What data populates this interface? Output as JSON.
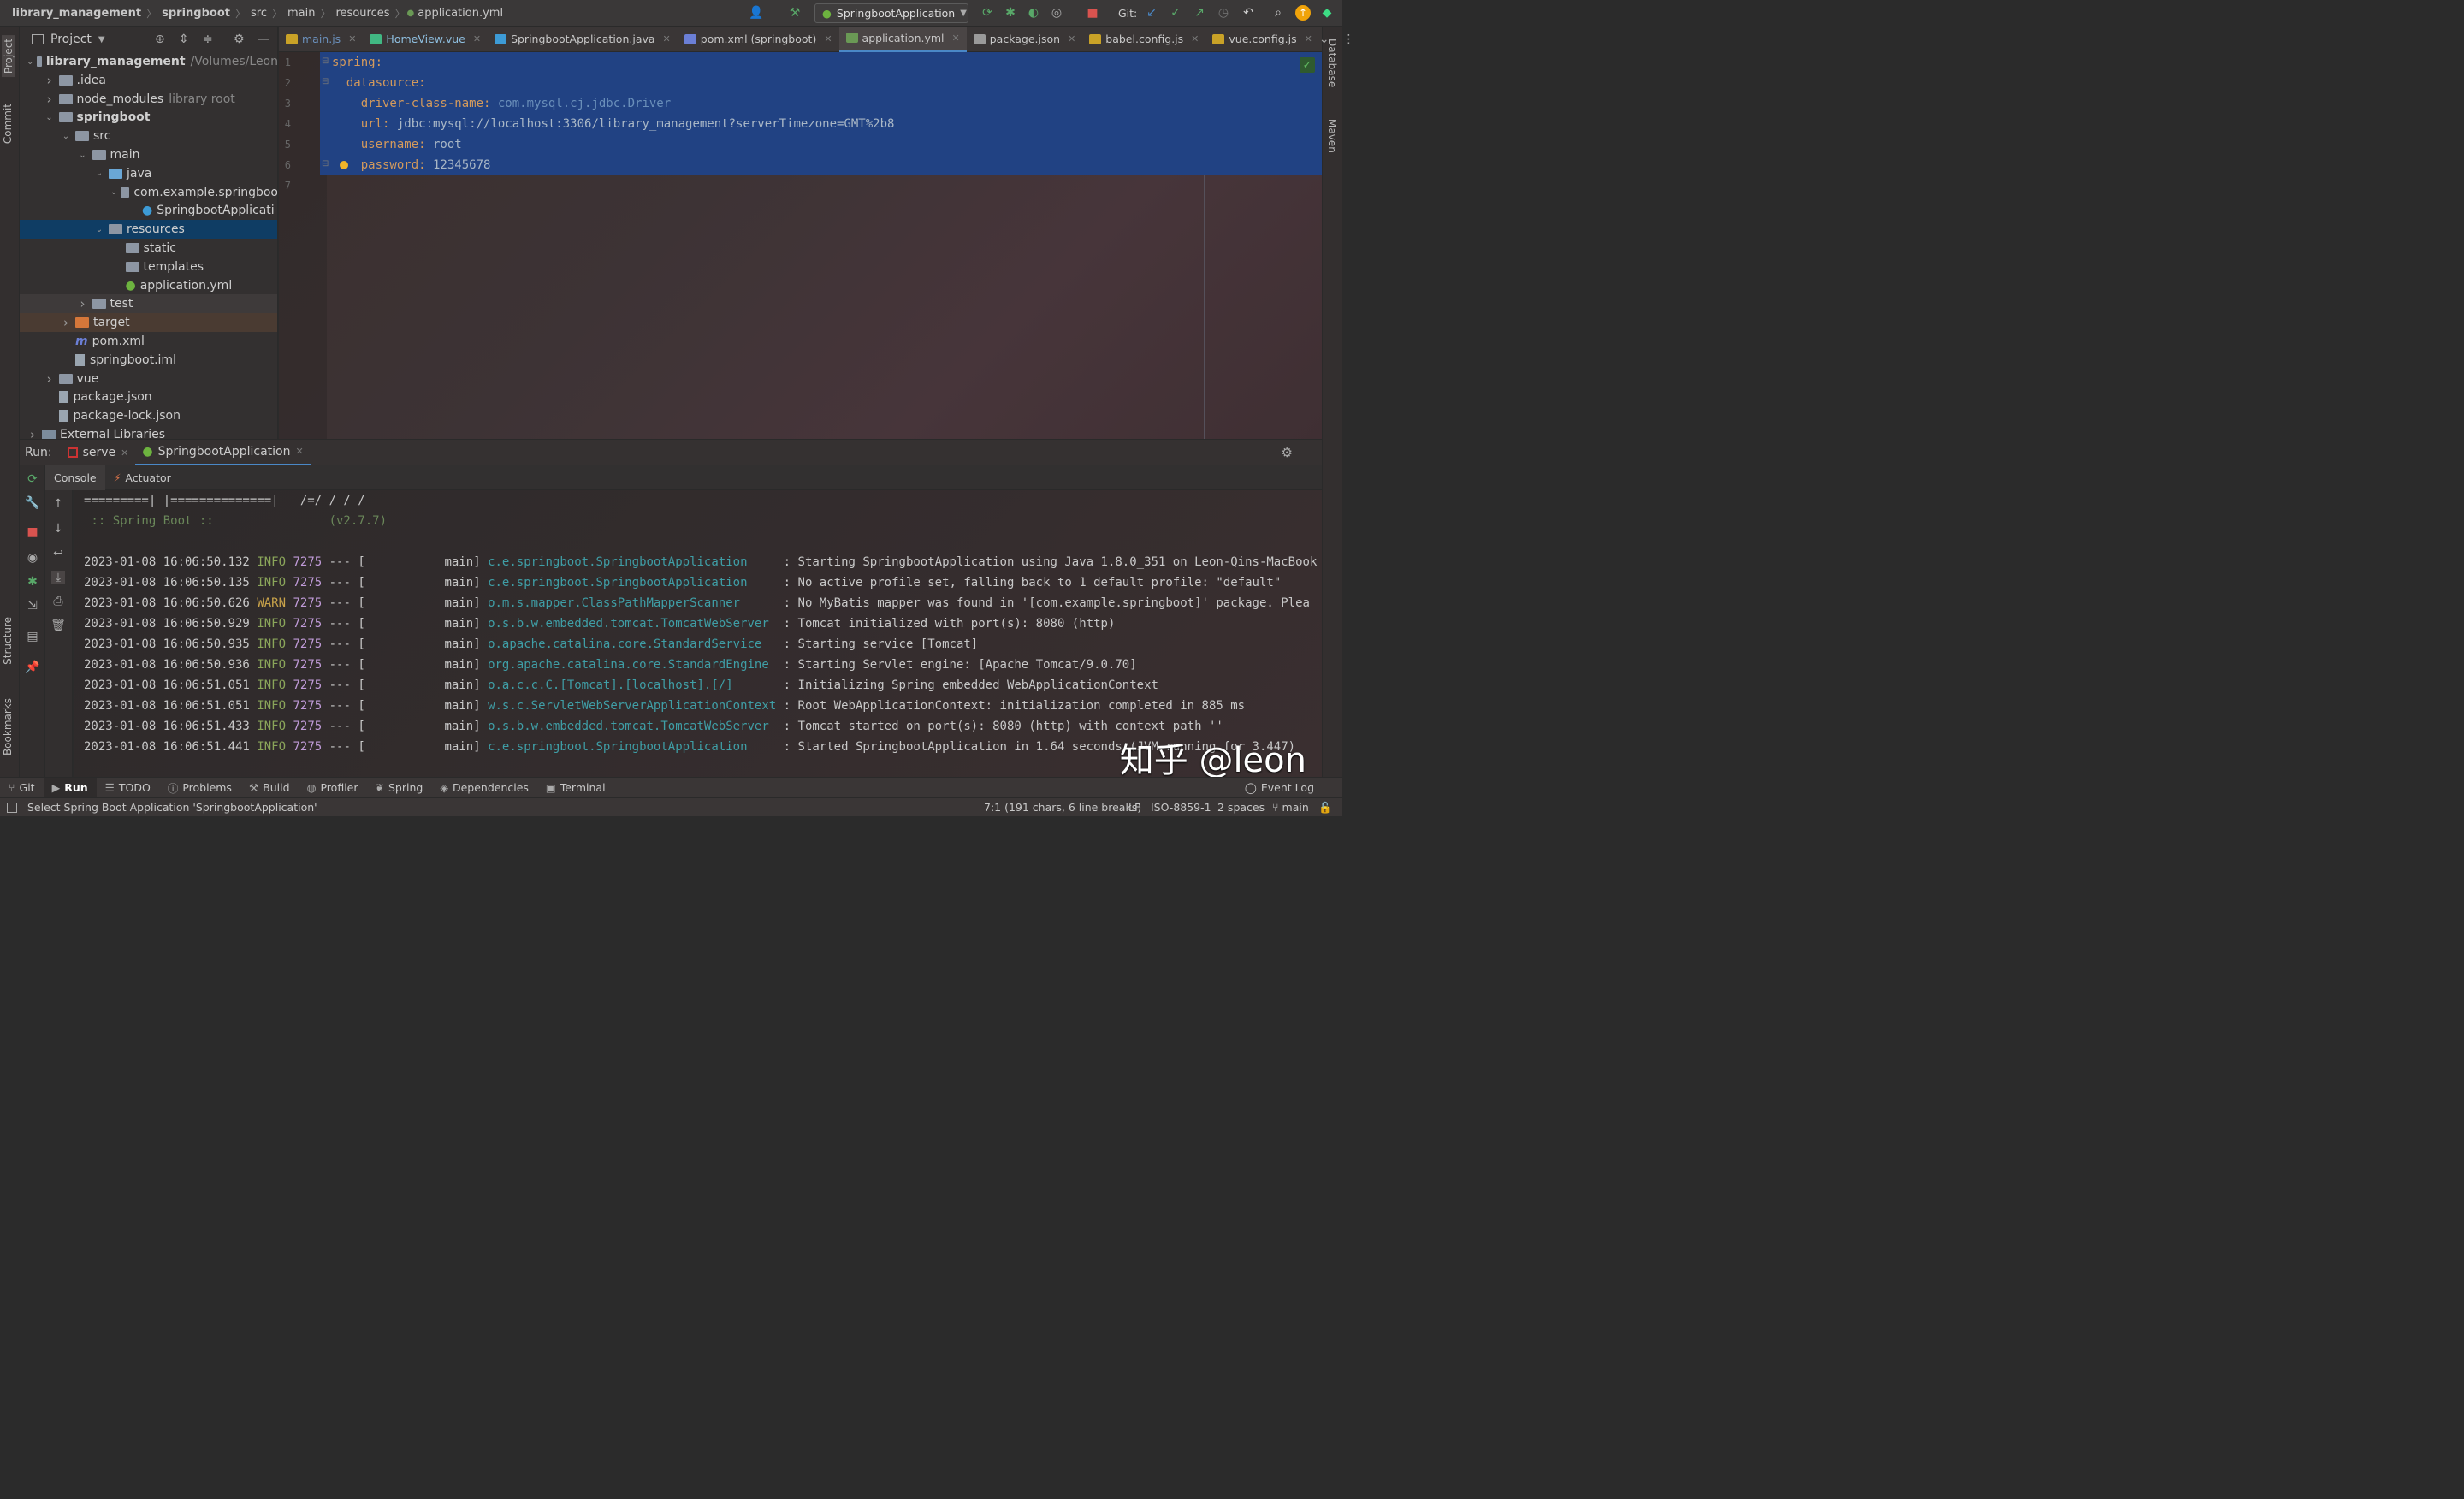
{
  "nav": {
    "crumbs": [
      "library_management",
      "springboot",
      "src",
      "main",
      "resources",
      "application.yml"
    ],
    "run_config": "SpringbootApplication",
    "git_label": "Git:"
  },
  "project": {
    "header": "Project",
    "tree": [
      {
        "label": "library_management",
        "extra": "/Volumes/Leon",
        "indent": 0,
        "arrow": "down",
        "icon": "folder",
        "bold": true
      },
      {
        "label": ".idea",
        "indent": 1,
        "arrow": "right",
        "icon": "folder"
      },
      {
        "label": "node_modules",
        "extra": "library root",
        "indent": 1,
        "arrow": "right",
        "icon": "folder"
      },
      {
        "label": "springboot",
        "indent": 1,
        "arrow": "down",
        "icon": "folder",
        "bold": true
      },
      {
        "label": "src",
        "indent": 2,
        "arrow": "down",
        "icon": "folder"
      },
      {
        "label": "main",
        "indent": 3,
        "arrow": "down",
        "icon": "folder"
      },
      {
        "label": "java",
        "indent": 4,
        "arrow": "down",
        "icon": "folder-blue"
      },
      {
        "label": "com.example.springboo",
        "indent": 5,
        "arrow": "down",
        "icon": "folder"
      },
      {
        "label": "SpringbootApplicati",
        "indent": 6,
        "arrow": "none",
        "icon": "spring"
      },
      {
        "label": "resources",
        "indent": 4,
        "arrow": "down",
        "icon": "folder-res",
        "state": "selected"
      },
      {
        "label": "static",
        "indent": 5,
        "arrow": "none",
        "icon": "folder"
      },
      {
        "label": "templates",
        "indent": 5,
        "arrow": "none",
        "icon": "folder"
      },
      {
        "label": "application.yml",
        "indent": 5,
        "arrow": "none",
        "icon": "yml"
      },
      {
        "label": "test",
        "indent": 3,
        "arrow": "right",
        "icon": "folder"
      },
      {
        "label": "target",
        "indent": 2,
        "arrow": "right",
        "icon": "folder-orange",
        "state": "target"
      },
      {
        "label": "pom.xml",
        "indent": 2,
        "arrow": "none",
        "icon": "maven"
      },
      {
        "label": "springboot.iml",
        "indent": 2,
        "arrow": "none",
        "icon": "file"
      },
      {
        "label": "vue",
        "indent": 1,
        "arrow": "right",
        "icon": "folder"
      },
      {
        "label": "package.json",
        "indent": 1,
        "arrow": "none",
        "icon": "file"
      },
      {
        "label": "package-lock.json",
        "indent": 1,
        "arrow": "none",
        "icon": "file"
      },
      {
        "label": "External Libraries",
        "indent": 0,
        "arrow": "right",
        "icon": "lib"
      }
    ]
  },
  "tabs": [
    {
      "label": "main.js",
      "icon_color": "#c9a227",
      "active": false
    },
    {
      "label": "HomeView.vue",
      "icon_color": "#41b883",
      "active": false
    },
    {
      "label": "SpringbootApplication.java",
      "icon_color": "#3d9bd6",
      "active": false
    },
    {
      "label": "pom.xml (springboot)",
      "icon_color": "#6b7fd6",
      "active": false
    },
    {
      "label": "application.yml",
      "icon_color": "#6a9955",
      "active": true
    },
    {
      "label": "package.json",
      "icon_color": "#9a9a9a",
      "active": false
    },
    {
      "label": "babel.config.js",
      "icon_color": "#c9a227",
      "active": false
    },
    {
      "label": "vue.config.js",
      "icon_color": "#c9a227",
      "active": false
    }
  ],
  "editor": {
    "lines": [
      {
        "num": "1",
        "key": "spring:",
        "value": "",
        "indent": ""
      },
      {
        "num": "2",
        "key": "datasource:",
        "value": "",
        "indent": "  "
      },
      {
        "num": "3",
        "key": "driver-class-name:",
        "value": " com.mysql.cj.jdbc.Driver",
        "indent": "    ",
        "value_style": "dim"
      },
      {
        "num": "4",
        "key": "url:",
        "value": " jdbc:mysql://localhost:3306/library_management?serverTimezone=GMT%2b8",
        "indent": "    "
      },
      {
        "num": "5",
        "key": "username:",
        "value": " root",
        "indent": "    "
      },
      {
        "num": "6",
        "key": "password:",
        "value": " 12345678",
        "indent": "    "
      },
      {
        "num": "7",
        "key": "",
        "value": "",
        "indent": ""
      }
    ]
  },
  "run": {
    "label": "Run:",
    "tabs": [
      "serve",
      "SpringbootApplication"
    ],
    "subtabs": [
      "Console",
      "Actuator"
    ],
    "banner": [
      "=========|_|==============|___/=/_/_/_/",
      " :: Spring Boot ::                (v2.7.7)"
    ],
    "logs": [
      {
        "ts": "2023-01-08 16:06:50.132",
        "level": "INFO",
        "pid": "7275",
        "logger": "c.e.springboot.SpringbootApplication    ",
        "msg": ": Starting SpringbootApplication using Java 1.8.0_351 on Leon-Qins-MacBook"
      },
      {
        "ts": "2023-01-08 16:06:50.135",
        "level": "INFO",
        "pid": "7275",
        "logger": "c.e.springboot.SpringbootApplication    ",
        "msg": ": No active profile set, falling back to 1 default profile: \"default\""
      },
      {
        "ts": "2023-01-08 16:06:50.626",
        "level": "WARN",
        "pid": "7275",
        "logger": "o.m.s.mapper.ClassPathMapperScanner     ",
        "msg": ": No MyBatis mapper was found in '[com.example.springboot]' package. Plea"
      },
      {
        "ts": "2023-01-08 16:06:50.929",
        "level": "INFO",
        "pid": "7275",
        "logger": "o.s.b.w.embedded.tomcat.TomcatWebServer ",
        "msg": ": Tomcat initialized with port(s): 8080 (http)"
      },
      {
        "ts": "2023-01-08 16:06:50.935",
        "level": "INFO",
        "pid": "7275",
        "logger": "o.apache.catalina.core.StandardService  ",
        "msg": ": Starting service [Tomcat]"
      },
      {
        "ts": "2023-01-08 16:06:50.936",
        "level": "INFO",
        "pid": "7275",
        "logger": "org.apache.catalina.core.StandardEngine ",
        "msg": ": Starting Servlet engine: [Apache Tomcat/9.0.70]"
      },
      {
        "ts": "2023-01-08 16:06:51.051",
        "level": "INFO",
        "pid": "7275",
        "logger": "o.a.c.c.C.[Tomcat].[localhost].[/]      ",
        "msg": ": Initializing Spring embedded WebApplicationContext"
      },
      {
        "ts": "2023-01-08 16:06:51.051",
        "level": "INFO",
        "pid": "7275",
        "logger": "w.s.c.ServletWebServerApplicationContext",
        "msg": ": Root WebApplicationContext: initialization completed in 885 ms"
      },
      {
        "ts": "2023-01-08 16:06:51.433",
        "level": "INFO",
        "pid": "7275",
        "logger": "o.s.b.w.embedded.tomcat.TomcatWebServer ",
        "msg": ": Tomcat started on port(s): 8080 (http) with context path ''"
      },
      {
        "ts": "2023-01-08 16:06:51.441",
        "level": "INFO",
        "pid": "7275",
        "logger": "c.e.springboot.SpringbootApplication    ",
        "msg": ": Started SpringbootApplication in 1.64 seconds (JVM running for 3.447)"
      }
    ],
    "log_separator": " --- [           main] "
  },
  "watermark": "知乎 @leon",
  "left_stripe": [
    "Project",
    "Commit",
    "Structure",
    "Bookmarks"
  ],
  "right_stripe": [
    "Database",
    "Maven"
  ],
  "tools": [
    "Git",
    "Run",
    "TODO",
    "Problems",
    "Build",
    "Profiler",
    "Spring",
    "Dependencies",
    "Terminal"
  ],
  "event_log": "Event Log",
  "status": {
    "message": "Select Spring Boot Application 'SpringbootApplication'",
    "position": "7:1 (191 chars, 6 line breaks)",
    "line_sep": "LF",
    "encoding": "ISO-8859-1",
    "indent": "2 spaces",
    "branch": "main"
  },
  "colors": {
    "accent": "#4a88c7",
    "selection": "#214283",
    "tree_selected": "#0f3d64"
  }
}
